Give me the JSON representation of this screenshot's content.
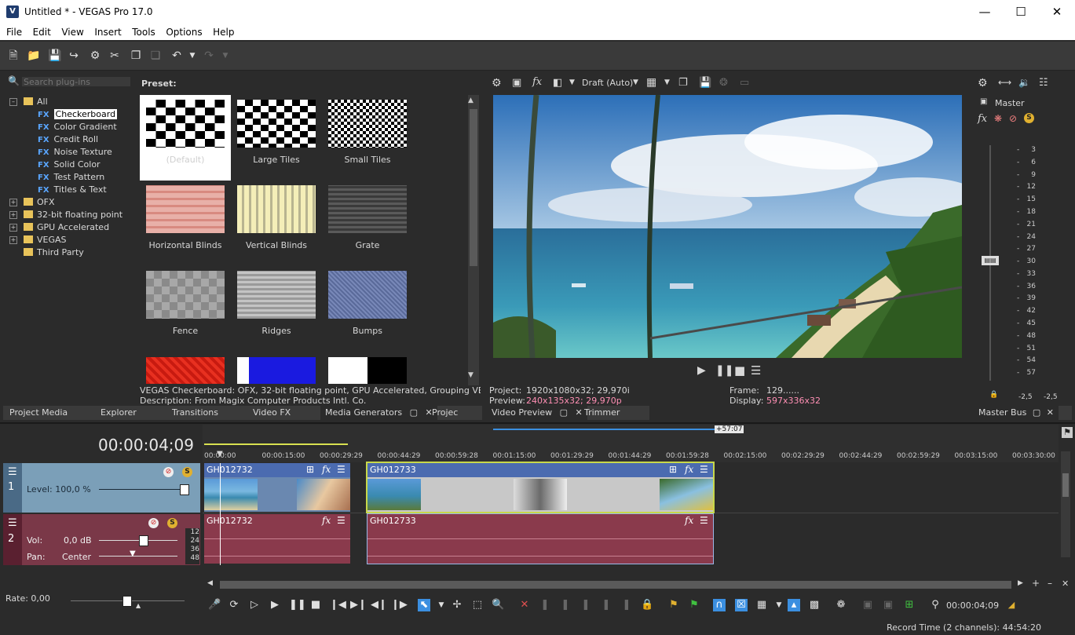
{
  "window": {
    "title": "Untitled * - VEGAS Pro 17.0",
    "app_icon": "V"
  },
  "menu": [
    "File",
    "Edit",
    "View",
    "Insert",
    "Tools",
    "Options",
    "Help"
  ],
  "plugins": {
    "search_placeholder": "Search plug-ins",
    "preset_header": "Preset:",
    "tree": [
      {
        "label": "All",
        "type": "folder",
        "expanded": true
      },
      {
        "label": "Checkerboard",
        "type": "fx",
        "selected": true
      },
      {
        "label": "Color Gradient",
        "type": "fx"
      },
      {
        "label": "Credit Roll",
        "type": "fx"
      },
      {
        "label": "Noise Texture",
        "type": "fx"
      },
      {
        "label": "Solid Color",
        "type": "fx"
      },
      {
        "label": "Test Pattern",
        "type": "fx"
      },
      {
        "label": "Titles & Text",
        "type": "fx"
      },
      {
        "label": "OFX",
        "type": "folder"
      },
      {
        "label": "32-bit floating point",
        "type": "folder"
      },
      {
        "label": "GPU Accelerated",
        "type": "folder"
      },
      {
        "label": "VEGAS",
        "type": "folder"
      },
      {
        "label": "Third Party",
        "type": "folder"
      }
    ],
    "fx_tag": "FX",
    "presets": [
      "(Default)",
      "Large Tiles",
      "Small Tiles",
      "Horizontal Blinds",
      "Vertical Blinds",
      "Grate",
      "Fence",
      "Ridges",
      "Bumps"
    ],
    "description_line1": "VEGAS Checkerboard: OFX, 32-bit floating point, GPU Accelerated, Grouping VEGAS, Versi",
    "description_line2": "Description: From Magix Computer Products Intl. Co."
  },
  "left_tabs": [
    "Project Media",
    "Explorer",
    "Transitions",
    "Video FX",
    "Media Generators",
    "Projec"
  ],
  "preview": {
    "quality": "Draft (Auto)",
    "project_label": "Project:",
    "project_value": "1920x1080x32; 29,970i",
    "preview_label": "Preview:",
    "preview_value": "240x135x32; 29,970p",
    "frame_label": "Frame:",
    "frame_value": "129......",
    "display_label": "Display:",
    "display_value": "597x336x32",
    "tabs": [
      "Video Preview",
      "Trimmer"
    ]
  },
  "master": {
    "label": "Master",
    "scale": [
      "3",
      "6",
      "9",
      "12",
      "15",
      "18",
      "21",
      "24",
      "27",
      "30",
      "33",
      "36",
      "39",
      "42",
      "45",
      "48",
      "51",
      "54",
      "57"
    ],
    "scale_left": [
      "-",
      "-",
      "-",
      "-",
      "-",
      "-",
      "-",
      "-",
      "-",
      "-",
      "-",
      "-",
      "-",
      "-",
      "-",
      "-",
      "-",
      "-",
      "-"
    ],
    "level_left": "-2,5",
    "level_right": "-2,5",
    "tab": "Master Bus"
  },
  "timeline": {
    "timecode": "00:00:04;09",
    "end_marker": "+57:07",
    "ruler": [
      "00:00:00",
      "00:00:15:00",
      "00:00:29:29",
      "00:00:44:29",
      "00:00:59:28",
      "00:01:15:00",
      "00:01:29:29",
      "00:01:44:29",
      "00:01:59:28",
      "00:02:15:00",
      "00:02:29:29",
      "00:02:44:29",
      "00:02:59:29",
      "00:03:15:00",
      "00:03:30:00"
    ],
    "video_track": {
      "number": "1",
      "level_label": "Level: 100,0 %",
      "level_fraction": 0.95
    },
    "audio_track": {
      "number": "2",
      "vol_label": "Vol:",
      "vol_value": "0,0 dB",
      "pan_label": "Pan:",
      "pan_value": "Center",
      "meter": [
        "12",
        "24",
        "36",
        "48"
      ]
    },
    "clips": {
      "video1": "GH012732",
      "video2": "GH012733",
      "audio1": "GH012732",
      "audio2": "GH012733"
    },
    "rate_label": "Rate: 0,00",
    "cursor_time": "00:00:04;09"
  },
  "status": {
    "record_time": "Record Time (2 channels): 44:54:20"
  },
  "colors": {
    "video_track": "#7b9fb8",
    "audio_track": "#7a3848",
    "video_clip_head": "#4b6bb0",
    "audio_clip": "#8a3a4c",
    "selection_outline": "#c8d84a",
    "accent_blue": "#3b8fe0"
  }
}
